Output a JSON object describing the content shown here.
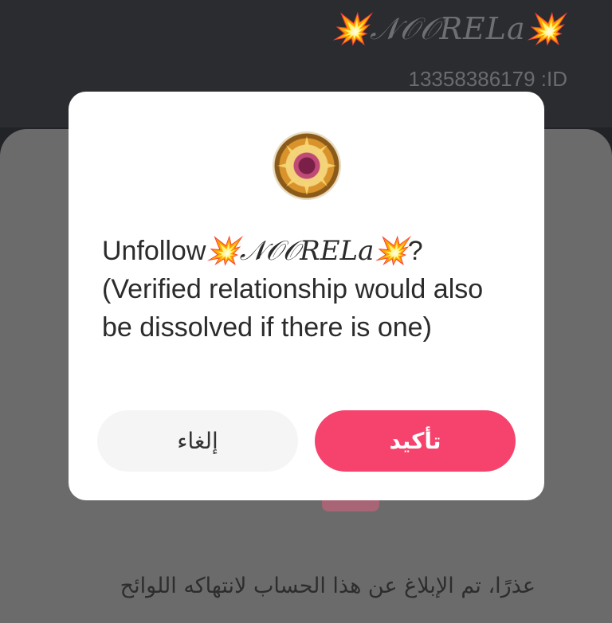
{
  "profile": {
    "name": "💥𝒩𝒪𝒪𝑅𝐸𝐿a💥",
    "id": "13358386179 :ID"
  },
  "notice": "عذرًا، تم الإبلاغ عن هذا الحساب لانتهاكه اللوائح",
  "dialog": {
    "message_prefix": "Unfollow",
    "message_name": "💥𝒩𝒪𝒪𝑅𝐸𝐿a💥",
    "message_suffix": "? (Verified relationship would also be dissolved if there is one)",
    "cancel_label": "إلغاء",
    "confirm_label": "تأكيد"
  },
  "colors": {
    "confirm": "#f5436d",
    "cancel_bg": "#f5f5f5",
    "overlay": "#222326"
  }
}
